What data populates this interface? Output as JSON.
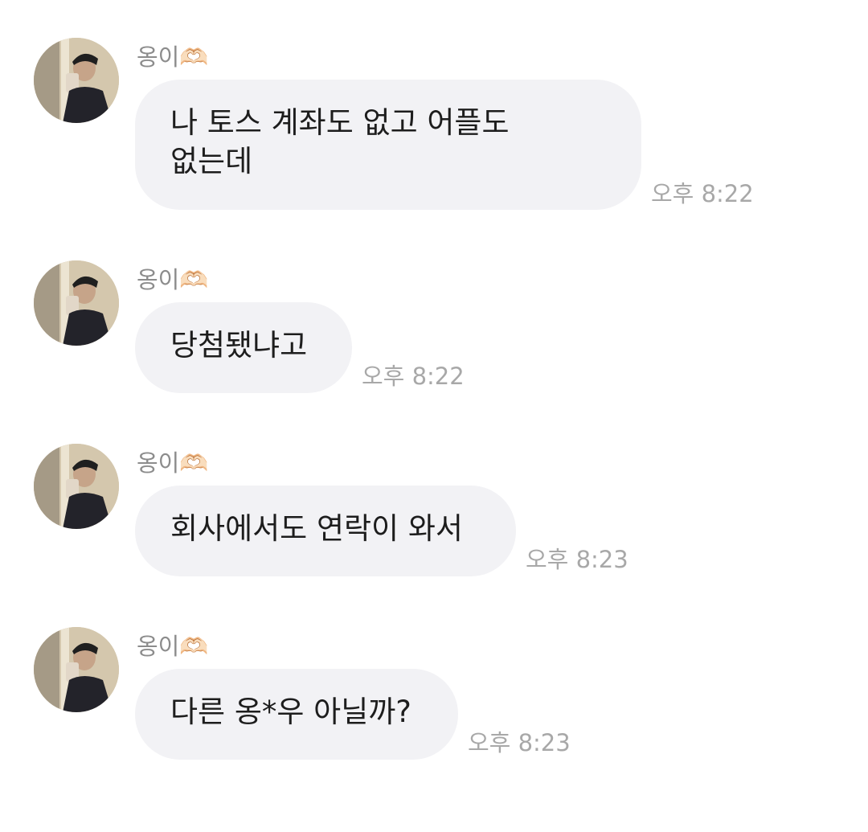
{
  "messages": [
    {
      "sender": "옹이🫶🏻",
      "text": "나 토스 계좌도 없고 어플도\n없는데",
      "time": "오후 8:22"
    },
    {
      "sender": "옹이🫶🏻",
      "text": "당첨됐냐고",
      "time": "오후 8:22"
    },
    {
      "sender": "옹이🫶🏻",
      "text": "회사에서도 연락이 와서",
      "time": "오후 8:23"
    },
    {
      "sender": "옹이🫶🏻",
      "text": "다른 옹*우 아닐까?",
      "time": "오후 8:23"
    }
  ],
  "colors": {
    "bubble": "#f2f2f5",
    "sender_text": "#8c8c8c",
    "time_text": "#a8a8a8",
    "message_text": "#1d1d1d"
  },
  "icons": {
    "avatar": "profile-photo"
  }
}
